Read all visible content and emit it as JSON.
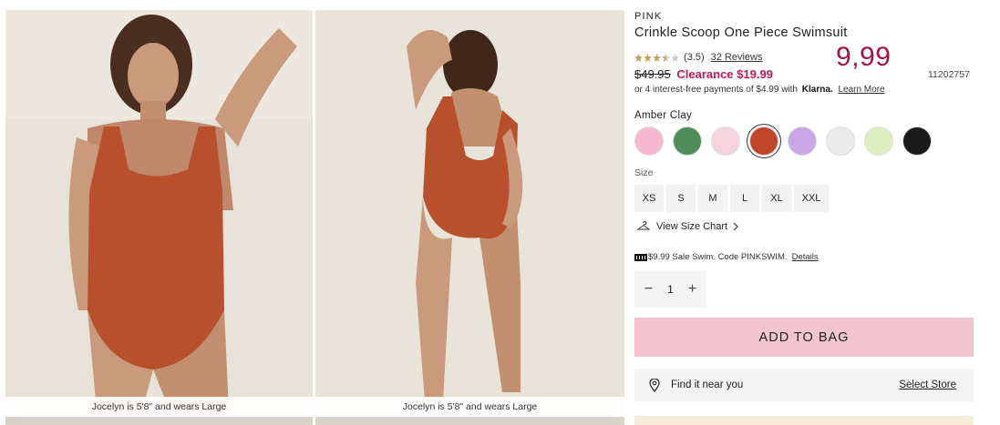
{
  "gallery": {
    "images": [
      {
        "caption": "Jocelyn is 5'8\" and wears Large",
        "subject": "model-front-orange-swimsuit"
      },
      {
        "caption": "Jocelyn is 5'8\" and wears Large",
        "subject": "model-back-orange-swimsuit"
      }
    ]
  },
  "product": {
    "brand": "PINK",
    "title": "Crinkle Scoop One Piece Swimsuit",
    "rating": {
      "value": "(3.5)",
      "stars": 3.5,
      "reviews": "32 Reviews"
    },
    "overlay_price": "9,99",
    "item_number": "11202757",
    "original_price": "$49.95",
    "sale_price": "Clearance $19.99",
    "klarna": {
      "text": "or 4 interest-free payments of $4.99 with",
      "brand": "Klarna.",
      "link": "Learn More"
    },
    "color_name": "Amber Clay",
    "swatches": [
      {
        "name": "pink",
        "color": "#f7b8cf"
      },
      {
        "name": "green",
        "color": "#4f8c5c"
      },
      {
        "name": "light-pink",
        "color": "#f6d3dd"
      },
      {
        "name": "amber-clay",
        "color": "#c0452b",
        "selected": true
      },
      {
        "name": "lavender",
        "color": "#c9a6e6"
      },
      {
        "name": "white",
        "color": "#ebebeb"
      },
      {
        "name": "lime",
        "color": "#dfeec0"
      },
      {
        "name": "black",
        "color": "#1a1a1a"
      }
    ],
    "size_label": "Size",
    "sizes": [
      "XS",
      "S",
      "M",
      "L",
      "XL",
      "XXL"
    ],
    "size_chart": "View Size Chart",
    "promo": {
      "text": "$9.99 Sale Swim. Code PINKSWIM.",
      "link": "Details"
    },
    "quantity": {
      "value": "1",
      "minus": "−",
      "plus": "+"
    },
    "add_to_bag": "ADD TO BAG",
    "find_store": {
      "label": "Find it near you",
      "link": "Select Store"
    }
  }
}
